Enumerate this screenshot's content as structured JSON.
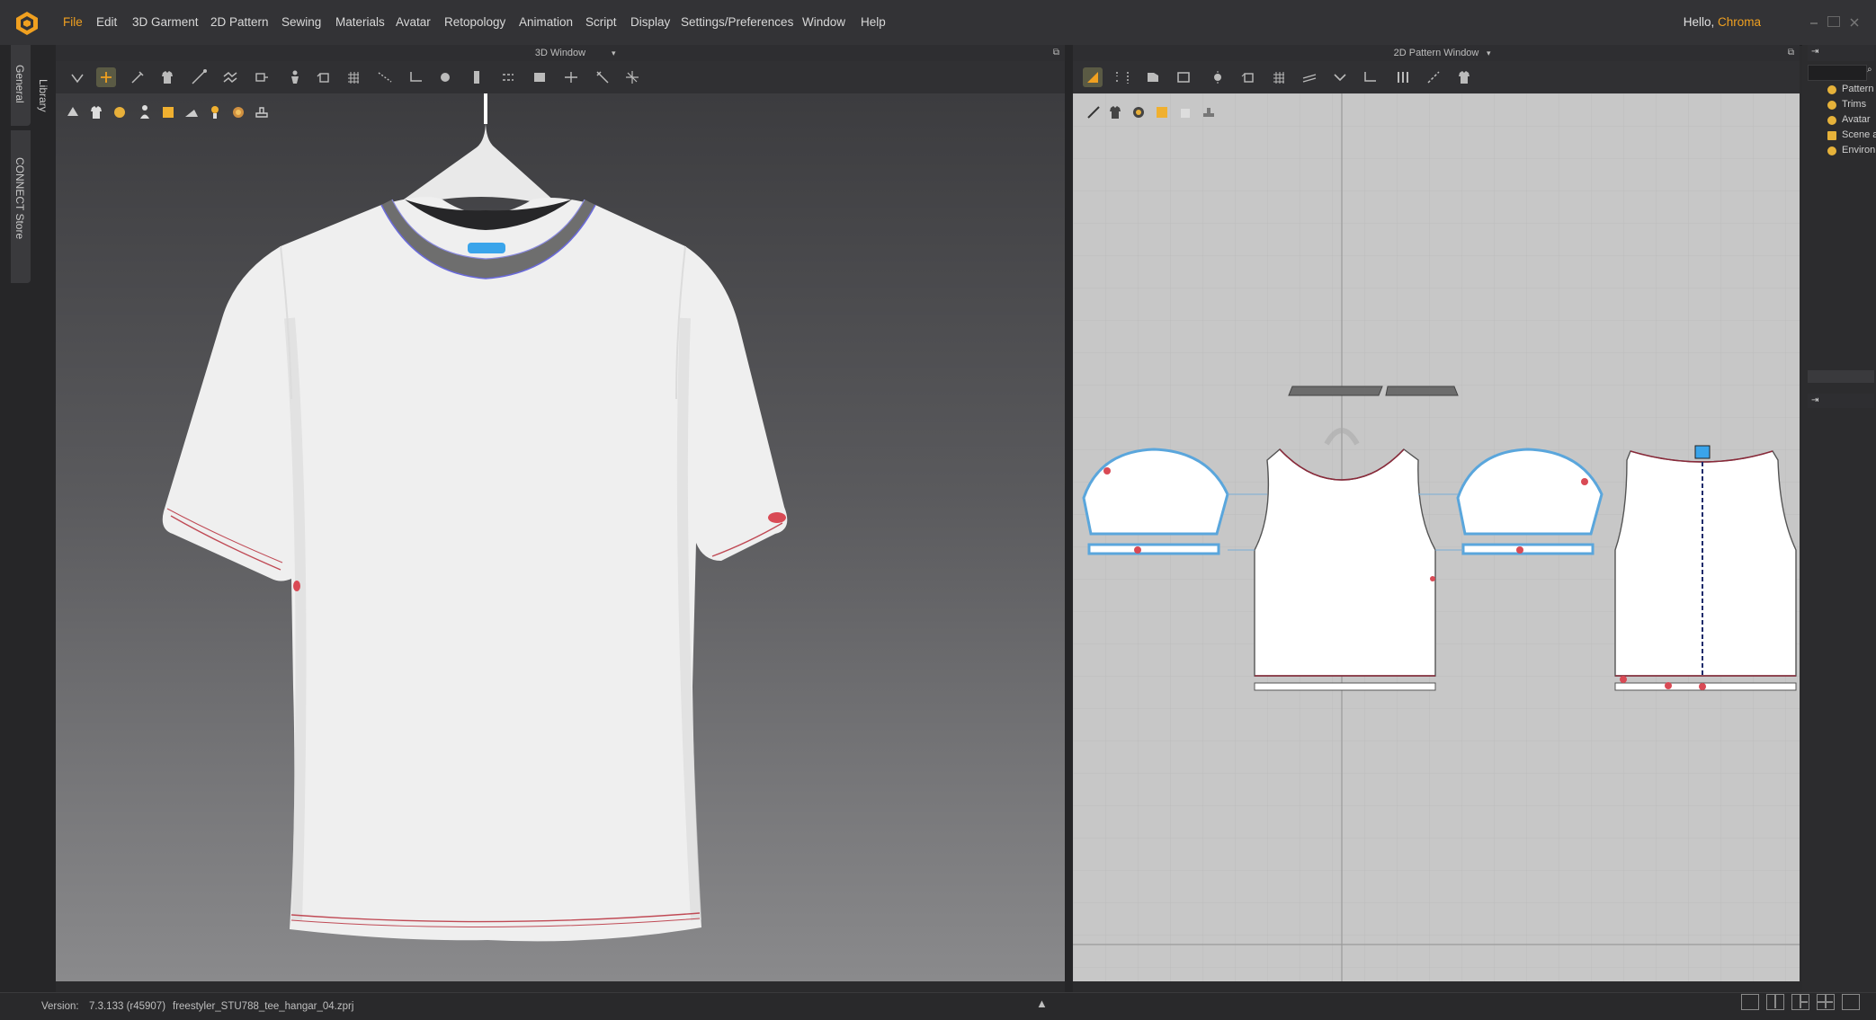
{
  "menu": {
    "items": [
      "File",
      "Edit",
      "3D Garment",
      "2D Pattern",
      "Sewing",
      "Materials",
      "Avatar",
      "Retopology",
      "Animation",
      "Script",
      "Display",
      "Settings/Preferences",
      "Window",
      "Help"
    ],
    "greeting": "Hello,",
    "user": "Chroma"
  },
  "side_tabs": {
    "general": "General",
    "library": "Library",
    "store": "CONNECT Store"
  },
  "windows": {
    "view3d_title": "3D Window",
    "view2d_title": "2D Pattern Window"
  },
  "object_browser": {
    "items": [
      {
        "label": "Pattern",
        "icon": "pattern-icon",
        "color": "#e6b23a"
      },
      {
        "label": "Trims",
        "icon": "trims-icon",
        "color": "#e6b23a"
      },
      {
        "label": "Avatar",
        "icon": "avatar-icon",
        "color": "#e6b23a"
      },
      {
        "label": "Scene a",
        "icon": "scene-icon",
        "color": "#e6b23a"
      },
      {
        "label": "Environ",
        "icon": "environment-icon",
        "color": "#e6b23a"
      }
    ]
  },
  "status": {
    "version_label": "Version:",
    "version": "7.3.133 (r45907)",
    "filename": "freestyler_STU788_tee_hangar_04.zprj"
  },
  "colors": {
    "accent": "#f0a020",
    "seam_red": "#d94a55",
    "pattern_blue": "#5aa6dc",
    "rib_gray": "#6a6a6a"
  }
}
